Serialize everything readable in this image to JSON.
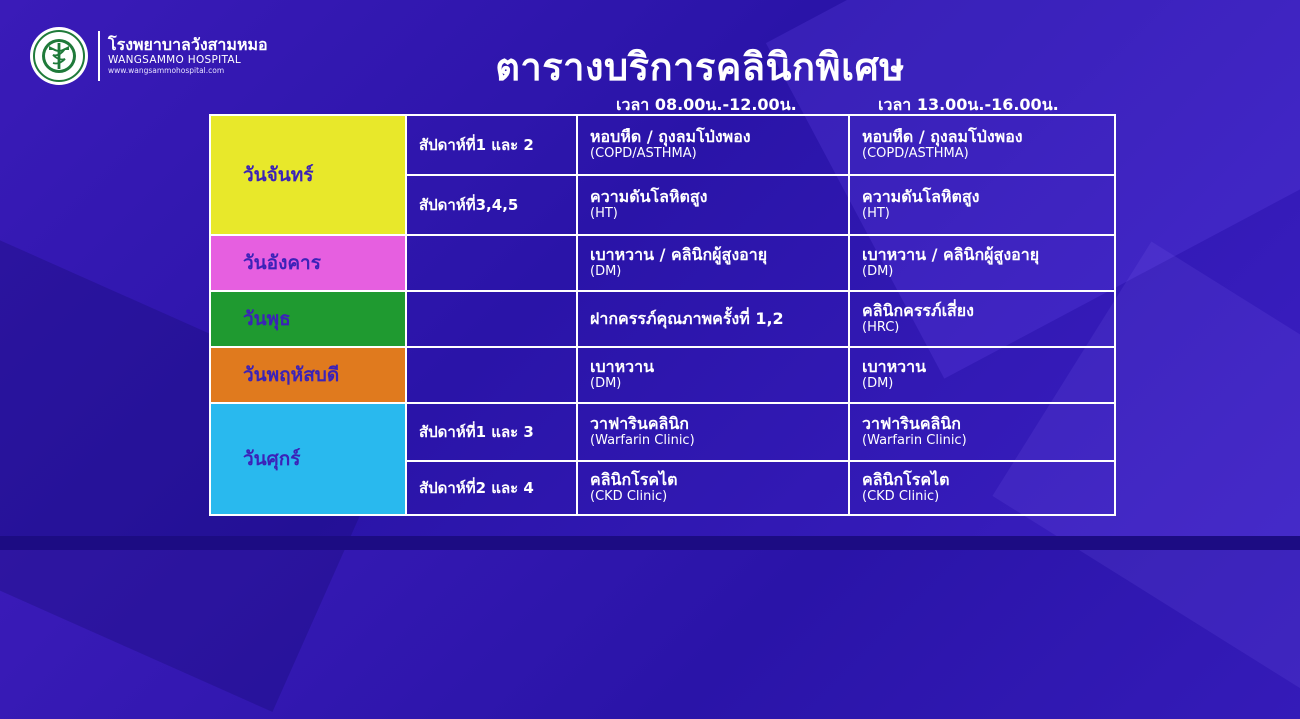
{
  "header": {
    "org_name_th": "โรงพยาบาลวังสามหมอ",
    "org_name_en": "WANGSAMMO HOSPITAL",
    "org_website": "www.wangsammohospital.com",
    "title": "ตารางบริการคลินิกพิเศษ"
  },
  "columns": {
    "morning": "เวลา 08.00น.-12.00น.",
    "afternoon": "เวลา 13.00น.-16.00น."
  },
  "colors": {
    "background": "#3a1bb8",
    "border": "#ffffff",
    "monday": "#e8e82a",
    "tuesday": "#e65fe0",
    "wednesday": "#1f9a30",
    "thursday": "#e07a1e",
    "friday": "#29b9ee",
    "day_text": "#3b22b8"
  },
  "schedule": {
    "monday": {
      "day": "วันจันทร์",
      "rows": [
        {
          "week": "สัปดาห์ที่1 และ 2",
          "am": {
            "th": "หอบหืด / ถุงลมโป่งพอง",
            "en": "(COPD/ASTHMA)"
          },
          "pm": {
            "th": "หอบหืด / ถุงลมโป่งพอง",
            "en": "(COPD/ASTHMA)"
          }
        },
        {
          "week": "สัปดาห์ที่3,4,5",
          "am": {
            "th": "ความดันโลหิตสูง",
            "en": "(HT)"
          },
          "pm": {
            "th": "ความดันโลหิตสูง",
            "en": "(HT)"
          }
        }
      ]
    },
    "tuesday": {
      "day": "วันอังคาร",
      "am": {
        "th": "เบาหวาน / คลินิกผู้สูงอายุ",
        "en": "(DM)"
      },
      "pm": {
        "th": "เบาหวาน / คลินิกผู้สูงอายุ",
        "en": "(DM)"
      }
    },
    "wednesday": {
      "day": "วันพุธ",
      "am": {
        "th": "ฝากครรภ์คุณภาพครั้งที่ 1,2"
      },
      "pm": {
        "th": "คลินิกครรภ์เสี่ยง",
        "en": "(HRC)"
      }
    },
    "thursday": {
      "day": "วันพฤหัสบดี",
      "am": {
        "th": "เบาหวาน",
        "en": "(DM)"
      },
      "pm": {
        "th": "เบาหวาน",
        "en": "(DM)"
      }
    },
    "friday": {
      "day": "วันศุกร์",
      "rows": [
        {
          "week": "สัปดาห์ที่1 และ 3",
          "am": {
            "th": "วาฟารินคลินิก",
            "en": "(Warfarin Clinic)"
          },
          "pm": {
            "th": "วาฟารินคลินิก",
            "en": "(Warfarin Clinic)"
          }
        },
        {
          "week": "สัปดาห์ที่2 และ 4",
          "am": {
            "th": "คลินิกโรคไต",
            "en": "(CKD Clinic)"
          },
          "pm": {
            "th": "คลินิกโรคไต",
            "en": "(CKD Clinic)"
          }
        }
      ]
    }
  }
}
